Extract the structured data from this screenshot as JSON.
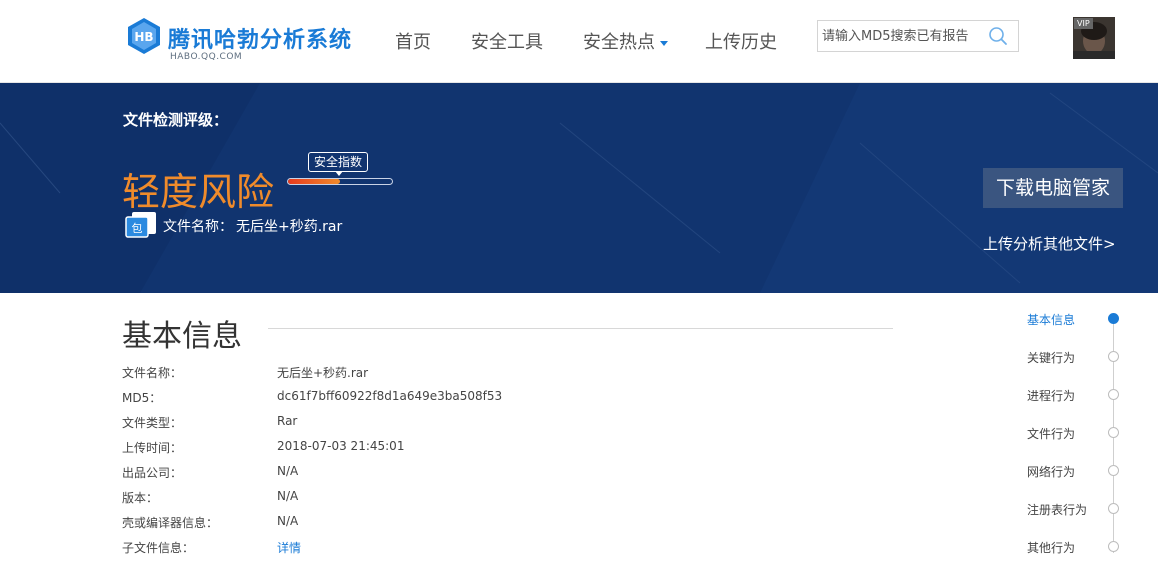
{
  "header": {
    "logo_title": "腾讯哈勃分析系统",
    "logo_sub": "HABO.QQ.COM",
    "nav": {
      "home": "首页",
      "tools": "安全工具",
      "hotspots": "安全热点",
      "history": "上传历史"
    },
    "search": {
      "placeholder": "请输入MD5搜索已有报告",
      "value": ""
    },
    "avatar": {
      "badge": "VIP"
    }
  },
  "colors": {
    "brand_blue": "#1a7bd6",
    "banner_bg": "#11346f",
    "risk_orange": "#f08b2b",
    "button_bg": "#3a5580"
  },
  "banner": {
    "grade_label": "文件检测评级：",
    "risk_level": "轻度风险",
    "score_tag": "安全指数",
    "score_fraction": 0.5,
    "file_label": "文件名称：",
    "file_name": "无后坐+秒药.rar",
    "file_icon_glyph": "包",
    "download_button": "下载电脑管家",
    "upload_link": "上传分析其他文件>"
  },
  "basic_info": {
    "title": "基本信息",
    "rows": [
      {
        "key": "文件名称：",
        "value": "无后坐+秒药.rar"
      },
      {
        "key": "MD5：",
        "value": "dc61f7bff60922f8d1a649e3ba508f53"
      },
      {
        "key": "文件类型：",
        "value": "Rar"
      },
      {
        "key": "上传时间：",
        "value": "2018-07-03 21:45:01"
      },
      {
        "key": "出品公司：",
        "value": "N/A"
      },
      {
        "key": "版本：",
        "value": "N/A"
      },
      {
        "key": "壳或编译器信息：",
        "value": "N/A"
      },
      {
        "key": "子文件信息：",
        "value": "详情"
      }
    ]
  },
  "timeline": {
    "items": [
      {
        "label": "基本信息",
        "active": true
      },
      {
        "label": "关键行为",
        "active": false
      },
      {
        "label": "进程行为",
        "active": false
      },
      {
        "label": "文件行为",
        "active": false
      },
      {
        "label": "网络行为",
        "active": false
      },
      {
        "label": "注册表行为",
        "active": false
      },
      {
        "label": "其他行为",
        "active": false
      }
    ]
  }
}
